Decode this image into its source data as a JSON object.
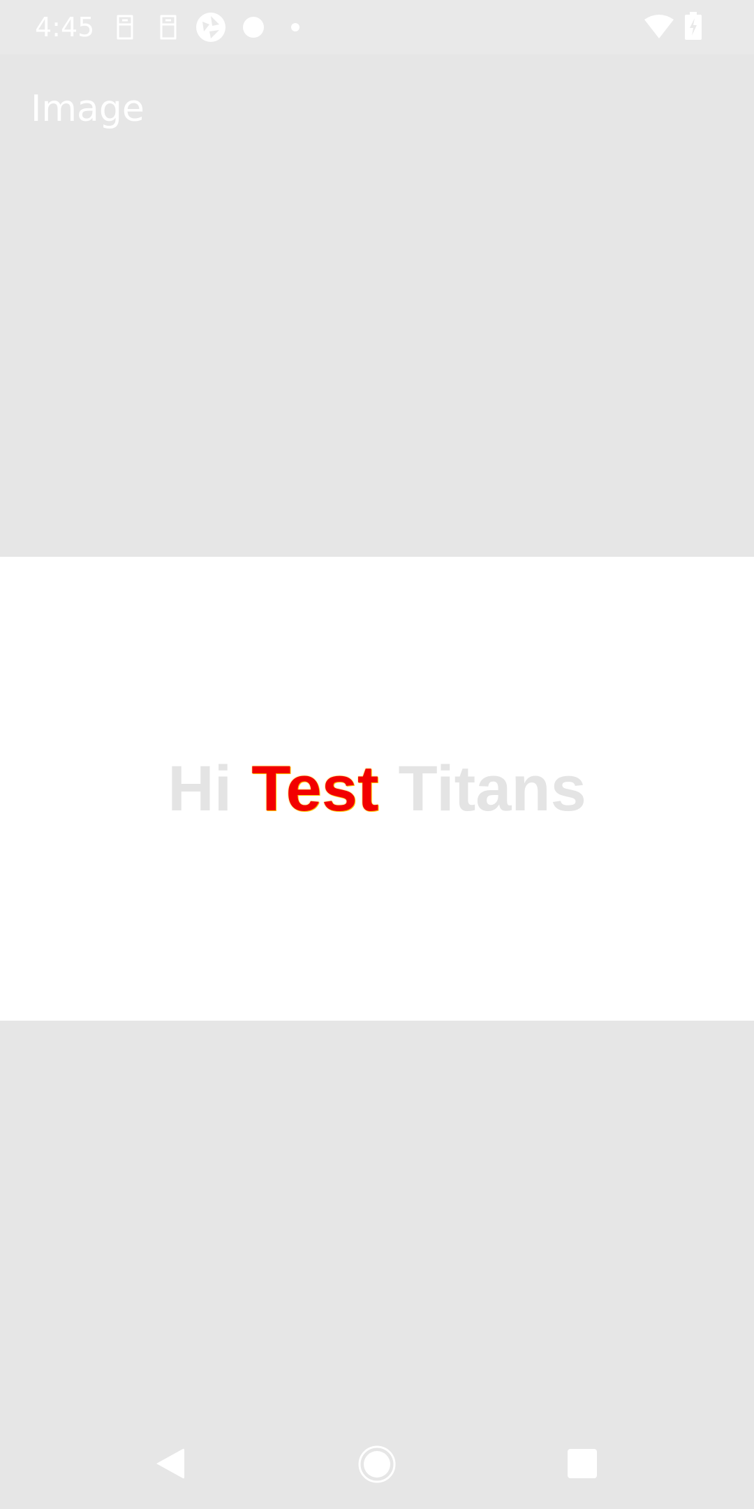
{
  "status_bar": {
    "time": "4:45",
    "notification_icons": [
      "sim-card-icon",
      "sim-card-icon",
      "camera-shutter-icon",
      "circle-icon",
      "dot-icon"
    ],
    "system_icons": [
      "wifi-icon",
      "battery-charging-icon"
    ]
  },
  "toolbar": {
    "title": "Image"
  },
  "image": {
    "words": [
      "Hi",
      "Test",
      "Titans"
    ],
    "highlight_color": "#f20000"
  },
  "nav_bar": {
    "buttons": [
      "back-icon",
      "home-icon",
      "recents-icon"
    ]
  },
  "colors": {
    "background": "#e6e6e6",
    "image_panel": "#ffffff",
    "faded_text": "#e4e4e4"
  }
}
